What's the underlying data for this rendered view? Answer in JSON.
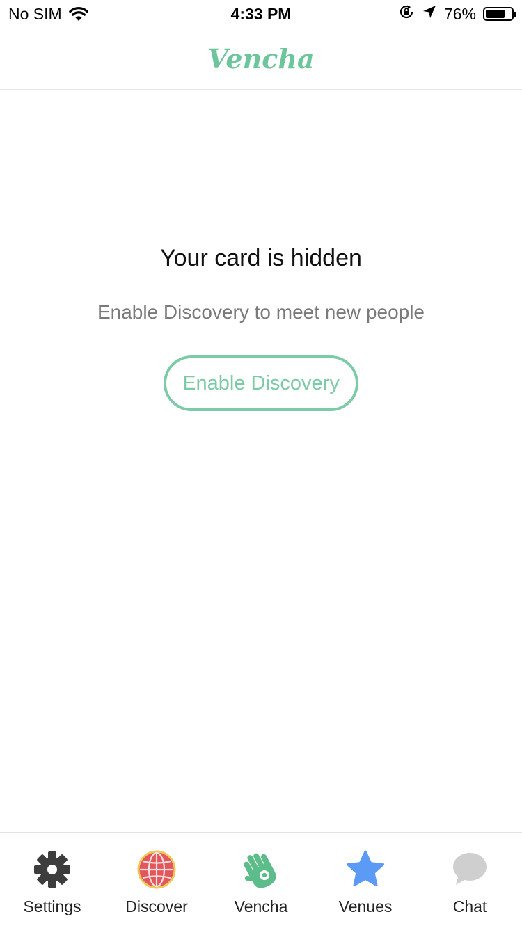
{
  "status_bar": {
    "carrier": "No SIM",
    "time": "4:33 PM",
    "battery_text": "76%",
    "battery_level": 0.76
  },
  "nav": {
    "title": "Vencha",
    "title_color": "#6cc59b"
  },
  "empty_state": {
    "title": "Your card is hidden",
    "subtitle": "Enable Discovery to meet new people",
    "button_label": "Enable Discovery",
    "accent_color": "#7dcaa6"
  },
  "tabs": [
    {
      "label": "Settings",
      "icon": "gear-icon"
    },
    {
      "label": "Discover",
      "icon": "globe-icon"
    },
    {
      "label": "Vencha",
      "icon": "hand-icon"
    },
    {
      "label": "Venues",
      "icon": "star-icon"
    },
    {
      "label": "Chat",
      "icon": "chat-bubble-icon"
    }
  ]
}
